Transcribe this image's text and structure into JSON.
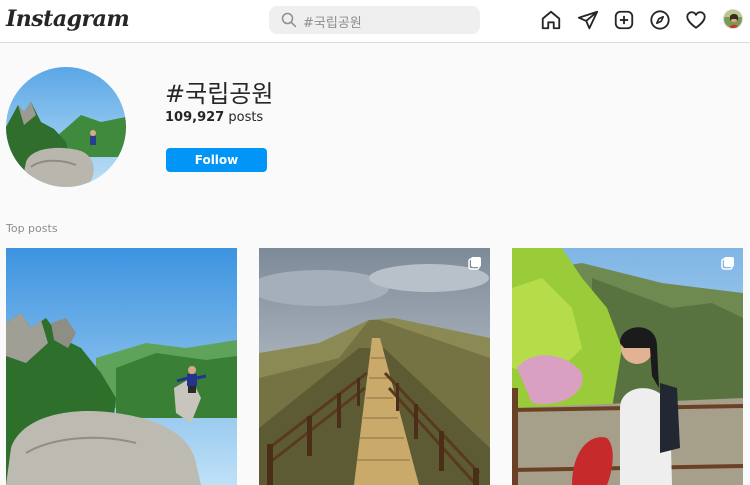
{
  "header": {
    "logo": "Instagram",
    "search": {
      "value": "#국립공원",
      "icon": "search-icon"
    },
    "nav_icons": [
      "home-icon",
      "direct-icon",
      "new-post-icon",
      "explore-icon",
      "activity-icon"
    ]
  },
  "tag": {
    "name": "#국립공원",
    "post_count": "109,927",
    "post_count_label": "posts",
    "follow_label": "Follow"
  },
  "top_posts": {
    "label": "Top posts",
    "posts": [
      {
        "multiple": false
      },
      {
        "multiple": true
      },
      {
        "multiple": true
      }
    ]
  },
  "colors": {
    "accent": "#0095f6",
    "background": "#fafafa",
    "text": "#262626",
    "muted": "#8e8e8e"
  }
}
